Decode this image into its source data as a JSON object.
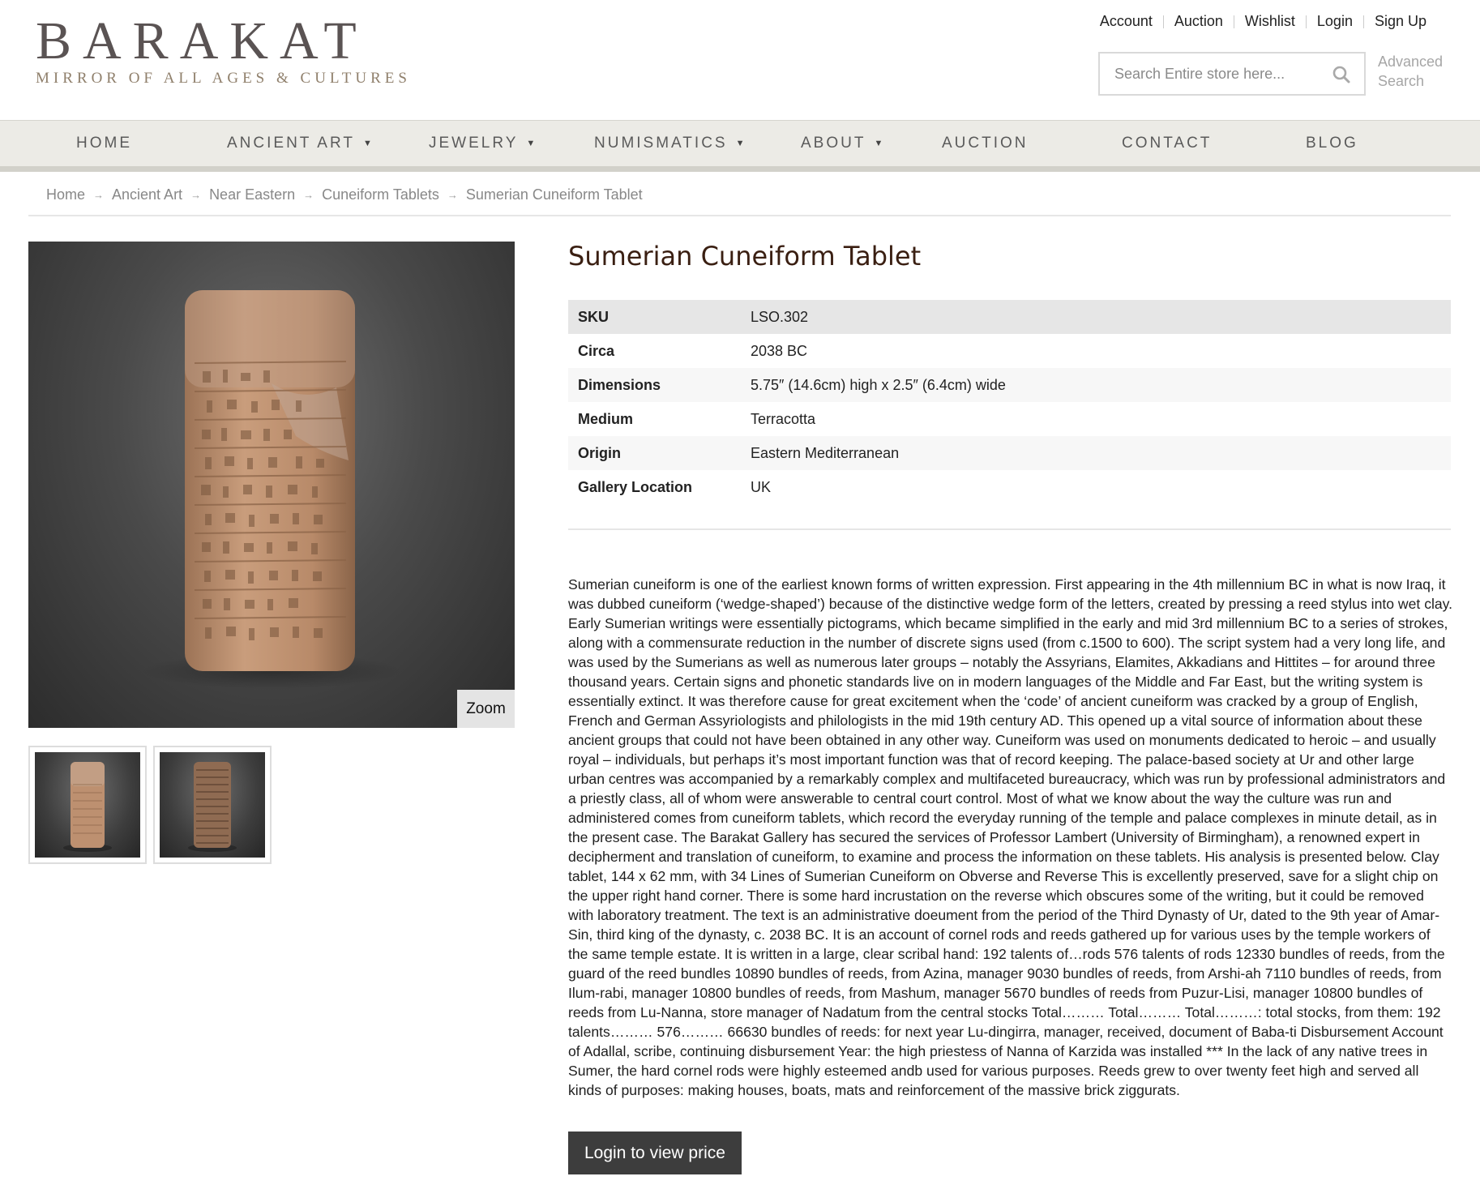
{
  "brand": {
    "name": "BARAKAT",
    "tagline": "MIRROR OF ALL AGES & CULTURES"
  },
  "top_links": [
    "Account",
    "Auction",
    "Wishlist",
    "Login",
    "Sign Up"
  ],
  "search": {
    "placeholder": "Search Entire store here...",
    "advanced_line1": "Advanced",
    "advanced_line2": "Search"
  },
  "nav": {
    "items": [
      {
        "label": "HOME"
      },
      {
        "label": "ANCIENT ART"
      },
      {
        "label": "JEWELRY"
      },
      {
        "label": "NUMISMATICS"
      },
      {
        "label": "ABOUT"
      },
      {
        "label": "AUCTION"
      },
      {
        "label": "CONTACT"
      },
      {
        "label": "BLOG"
      }
    ]
  },
  "breadcrumb": [
    "Home",
    "Ancient Art",
    "Near Eastern",
    "Cuneiform Tablets",
    "Sumerian Cuneiform Tablet"
  ],
  "product": {
    "title": "Sumerian Cuneiform Tablet",
    "zoom_label": "Zoom",
    "attributes": [
      {
        "label": "SKU",
        "value": "LSO.302"
      },
      {
        "label": "Circa",
        "value": "2038 BC"
      },
      {
        "label": "Dimensions",
        "value": "5.75″ (14.6cm) high x 2.5″ (6.4cm) wide"
      },
      {
        "label": "Medium",
        "value": "Terracotta"
      },
      {
        "label": "Origin",
        "value": "Eastern Mediterranean"
      },
      {
        "label": "Gallery Location",
        "value": "UK"
      }
    ],
    "description": "Sumerian cuneiform is one of the earliest known forms of written expression. First appearing in the 4th millennium BC in what is now Iraq, it was dubbed cuneiform (‘wedge-shaped’) because of the distinctive wedge form of the letters, created by pressing a reed stylus into wet clay. Early Sumerian writings were essentially pictograms, which became simplified in the early and mid 3rd millennium BC to a series of strokes, along with a commensurate reduction in the number of discrete signs used (from c.1500 to 600). The script system had a very long life, and was used by the Sumerians as well as numerous later groups – notably the Assyrians, Elamites, Akkadians and Hittites – for around three thousand years. Certain signs and phonetic standards live on in modern languages of the Middle and Far East, but the writing system is essentially extinct. It was therefore cause for great excitement when the ‘code’ of ancient cuneiform was cracked by a group of English, French and German Assyriologists and philologists in the mid 19th century AD. This opened up a vital source of information about these ancient groups that could not have been obtained in any other way. Cuneiform was used on monuments dedicated to heroic – and usually royal – individuals, but perhaps it’s most important function was that of record keeping. The palace-based society at Ur and other large urban centres was accompanied by a remarkably complex and multifaceted bureaucracy, which was run by professional administrators and a priestly class, all of whom were answerable to central court control. Most of what we know about the way the culture was run and administered comes from cuneiform tablets, which record the everyday running of the temple and palace complexes in minute detail, as in the present case. The Barakat Gallery has secured the services of Professor Lambert (University of Birmingham), a renowned expert in decipherment and translation of cuneiform, to examine and process the information on these tablets. His analysis is presented below. Clay tablet, 144 x 62 mm, with 34 Lines of Sumerian Cuneiform on Obverse and Reverse This is excellently preserved, save for a slight chip on the upper right hand corner. There is some hard incrustation on the reverse which obscures some of the writing, but it could be removed with laboratory treatment. The text is an administrative doeument from the period of the Third Dynasty of Ur, dated to the 9th year of Amar-Sin, third king of the dynasty, c. 2038 BC. It is an account of cornel rods and reeds gathered up for various uses by the temple workers of the same temple estate. It is written in a large, clear scribal hand: 192 talents of…rods 576 talents of rods 12330 bundles of reeds, from the guard of the reed bundles 10890 bundles of reeds, from Azina, manager 9030 bundles of reeds, from Arshi-ah 7110 bundles of reeds, from Ilum-rabi, manager 10800 bundles of reeds, from Mashum, manager 5670 bundles of reeds from Puzur-Lisi, manager 10800 bundles of reeds from Lu-Nanna, store manager of Nadatum from the central stocks Total……… Total……… Total………: total stocks, from them: 192 talents……… 576……… 66630 bundles of reeds: for next year Lu-dingirra, manager, received, document of Baba-ti Disbursement Account of Adallal, scribe, continuing disbursement Year: the high priestess of Nanna of Karzida was installed *** In the lack of any native trees in Sumer, the hard cornel rods were highly esteemed andb used for various purposes. Reeds grew to over twenty feet high and served all kinds of purposes: making houses, boats, mats and reinforcement of the massive brick ziggurats.",
    "login_button": "Login to view price"
  }
}
